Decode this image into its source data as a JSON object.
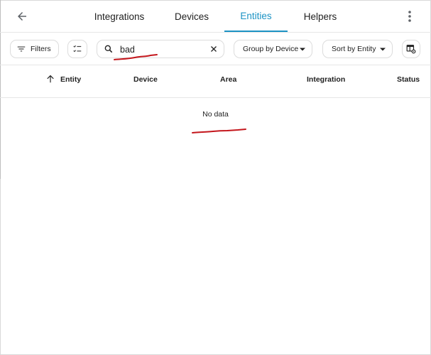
{
  "header": {
    "back_icon": "arrow-left-icon",
    "tabs": [
      {
        "label": "Integrations",
        "active": false
      },
      {
        "label": "Devices",
        "active": false
      },
      {
        "label": "Entities",
        "active": true
      },
      {
        "label": "Helpers",
        "active": false
      }
    ],
    "overflow_icon": "dots-vertical-icon",
    "accent_color": "#1c93c4"
  },
  "toolbar": {
    "filters_label": "Filters",
    "search": {
      "value": "bad",
      "placeholder": ""
    },
    "group_by_label": "Group by Device",
    "sort_by_label": "Sort by Entity"
  },
  "table": {
    "columns": [
      "Entity",
      "Device",
      "Area",
      "Integration",
      "Status"
    ],
    "sort_column": "Entity",
    "sort_direction": "ascending",
    "empty_message": "No data"
  },
  "annotation_color": "#c4161c"
}
